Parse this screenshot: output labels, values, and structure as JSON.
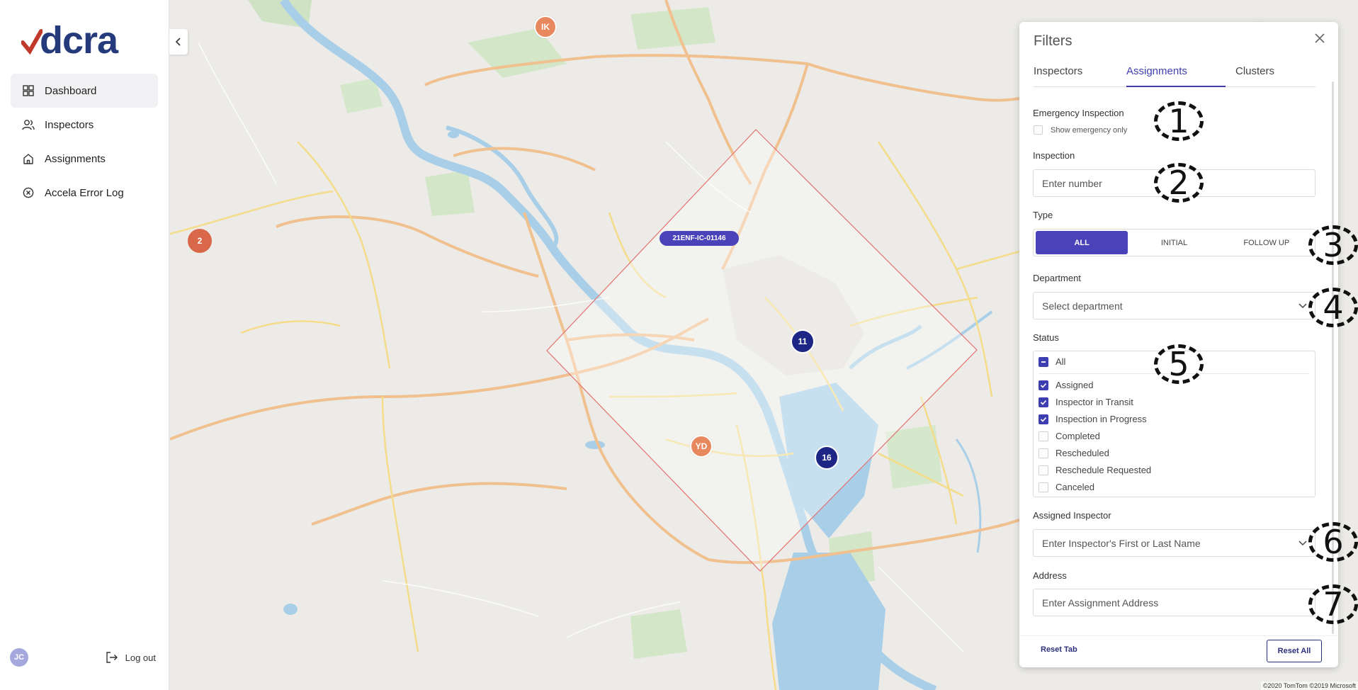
{
  "brand": {
    "logo_text": "dcra"
  },
  "sidebar": {
    "items": [
      {
        "label": "Dashboard",
        "icon": "dashboard-icon",
        "active": true
      },
      {
        "label": "Inspectors",
        "icon": "users-icon",
        "active": false
      },
      {
        "label": "Assignments",
        "icon": "home-icon",
        "active": false
      },
      {
        "label": "Accela Error Log",
        "icon": "error-circle-icon",
        "active": false
      }
    ],
    "user_initials": "JC",
    "logout_label": "Log out"
  },
  "map": {
    "markers": [
      {
        "label": "IK",
        "kind": "inspector"
      },
      {
        "label": "2",
        "kind": "cluster"
      },
      {
        "label": "YD",
        "kind": "inspector"
      },
      {
        "label": "11",
        "kind": "cluster"
      },
      {
        "label": "16",
        "kind": "cluster"
      }
    ],
    "assignment_label": "21ENF-IC-01146",
    "copyright": "©2020 TomTom ©2019 Microsoft"
  },
  "filters": {
    "title": "Filters",
    "tabs": [
      "Inspectors",
      "Assignments",
      "Clusters"
    ],
    "active_tab": "Assignments",
    "emergency": {
      "label": "Emergency Inspection",
      "checkbox_label": "Show emergency only",
      "checked": false
    },
    "inspection": {
      "label": "Inspection",
      "placeholder": "Enter number"
    },
    "type": {
      "label": "Type",
      "options": [
        "ALL",
        "INITIAL",
        "FOLLOW UP"
      ],
      "selected": "ALL"
    },
    "department": {
      "label": "Department",
      "placeholder": "Select department"
    },
    "status": {
      "label": "Status",
      "all_label": "All",
      "items": [
        {
          "label": "Assigned",
          "checked": true
        },
        {
          "label": "Inspector in Transit",
          "checked": true
        },
        {
          "label": "Inspection in Progress",
          "checked": true
        },
        {
          "label": "Completed",
          "checked": false
        },
        {
          "label": "Rescheduled",
          "checked": false
        },
        {
          "label": "Reschedule Requested",
          "checked": false
        },
        {
          "label": "Canceled",
          "checked": false
        }
      ]
    },
    "assigned_inspector": {
      "label": "Assigned Inspector",
      "placeholder": "Enter Inspector's First or Last Name"
    },
    "address": {
      "label": "Address",
      "placeholder": "Enter Assignment Address"
    },
    "reset_tab": "Reset Tab",
    "reset_all": "Reset All"
  },
  "callouts": [
    "1",
    "2",
    "3",
    "4",
    "5",
    "6",
    "7"
  ],
  "colors": {
    "accent": "#4a42b8",
    "brand_navy": "#243a7a",
    "brand_red": "#c0392b"
  }
}
